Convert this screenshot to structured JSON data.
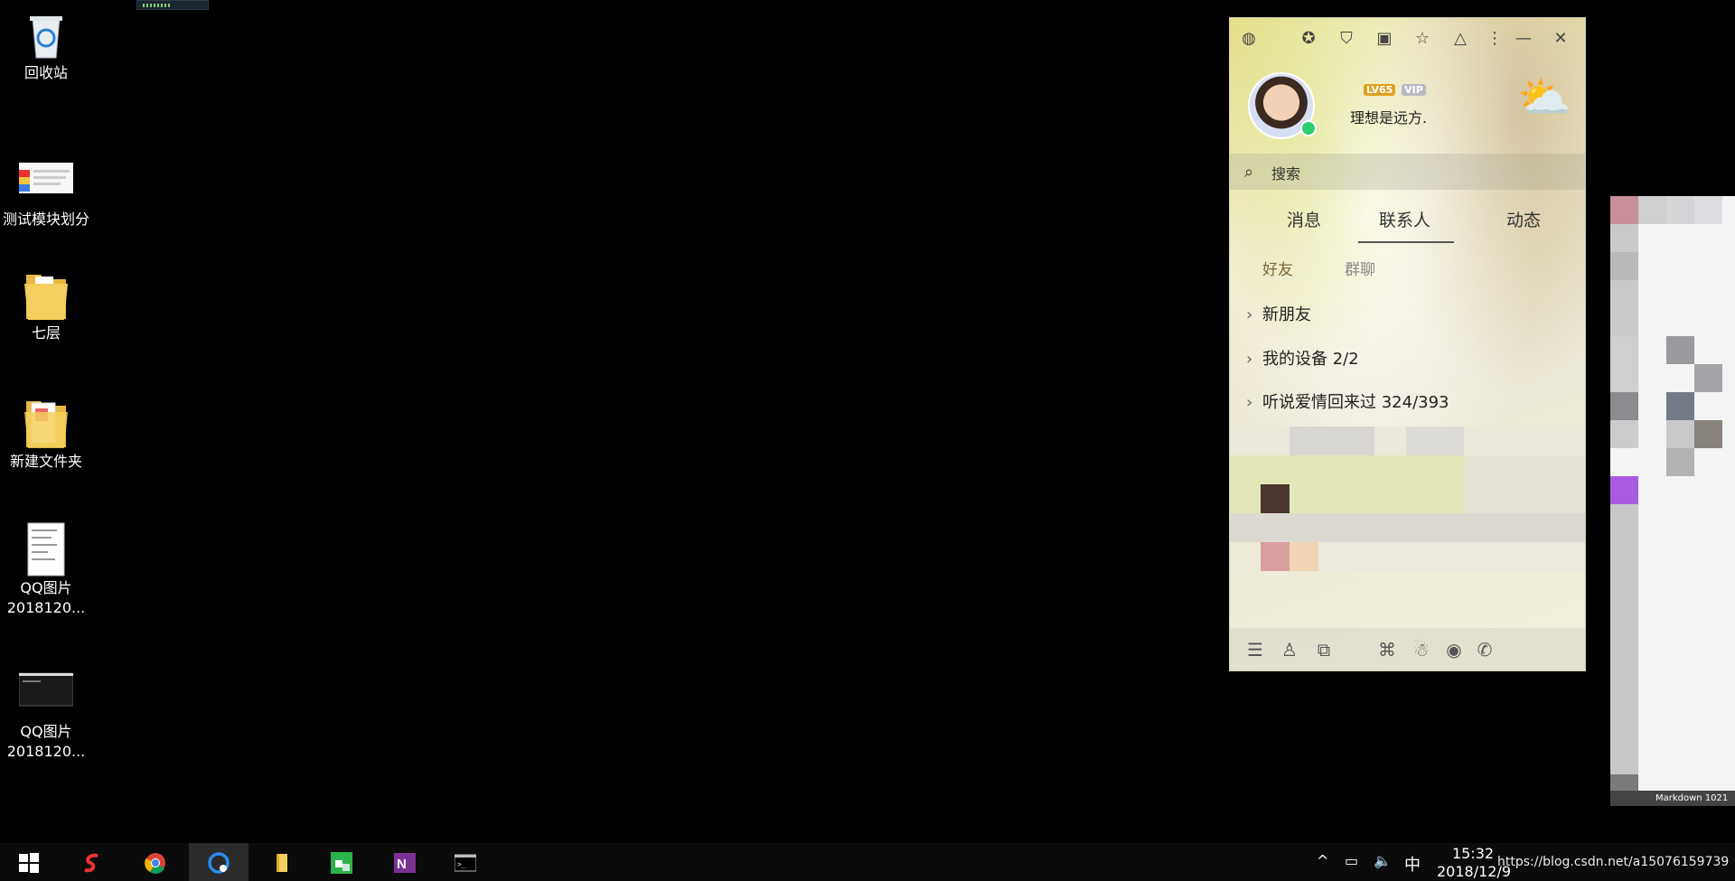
{
  "desktop": {
    "icons": [
      {
        "label": "回收站",
        "kind": "recycle-bin"
      },
      {
        "label": "测试模块划分",
        "kind": "image-thumb"
      },
      {
        "label": "七层",
        "kind": "folder"
      },
      {
        "label": "新建文件夹",
        "kind": "folder-docs"
      },
      {
        "label": "QQ图片\n2018120...",
        "kind": "image-doc"
      },
      {
        "label": "QQ图片\n2018120...",
        "kind": "image-dark"
      }
    ]
  },
  "qq": {
    "badges": {
      "level": "LV65",
      "vip": "VIP"
    },
    "signature": "理想是远方.",
    "search_placeholder": "搜索",
    "tabs": [
      "消息",
      "联系人",
      "动态"
    ],
    "active_tab": "联系人",
    "subtabs": [
      "好友",
      "群聊"
    ],
    "active_subtab": "好友",
    "groups": [
      {
        "label": "新朋友"
      },
      {
        "label": "我的设备 2/2"
      },
      {
        "label": "听说爱情回来过 324/393"
      }
    ],
    "colors": {
      "accent": "#7a6a3a",
      "online": "#2ecc71"
    }
  },
  "right_window": {
    "footer": "Markdown  1021"
  },
  "taskbar": {
    "apps": [
      "start",
      "ime-app",
      "chrome",
      "qq",
      "file-explorer",
      "wechat-work",
      "onenote",
      "terminal"
    ],
    "tray_ime": "中",
    "time": "15:32",
    "date": "2018/12/9"
  },
  "watermark": "https://blog.csdn.net/a15076159739"
}
